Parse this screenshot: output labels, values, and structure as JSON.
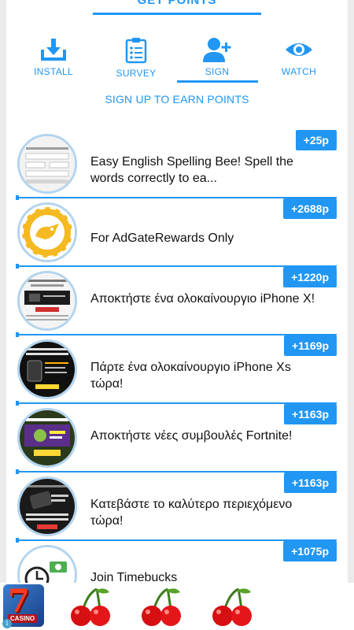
{
  "header": {
    "get_points_label": "GET POINTS"
  },
  "tabs": [
    {
      "label": "INSTALL",
      "icon": "download-icon"
    },
    {
      "label": "SURVEY",
      "icon": "clipboard-icon"
    },
    {
      "label": "SIGN",
      "icon": "add-user-icon",
      "active": true
    },
    {
      "label": "WATCH",
      "icon": "eye-icon"
    }
  ],
  "subtitle": "SIGN UP TO EARN POINTS",
  "offers": [
    {
      "points": "+25p",
      "title": "Easy English Spelling Bee! Spell the words correctly to ea..."
    },
    {
      "points": "+2688p",
      "title": "For AdGateRewards Only"
    },
    {
      "points": "+1220p",
      "title": "Αποκτήστε ένα ολοκαίνουργιο iPhone X!"
    },
    {
      "points": "+1169p",
      "title": "Πάρτε ένα ολοκαίνουργιο iPhone Xs τώρα!"
    },
    {
      "points": "+1163p",
      "title": "Αποκτήστε νέες συμβουλές Fortnite!"
    },
    {
      "points": "+1163p",
      "title": "Κατεβάστε το καλύτερο περιεχόμενο τώρα!"
    },
    {
      "points": "+1075p",
      "title": "Join Timebucks"
    }
  ],
  "ad": {
    "casino_label": "CASINO",
    "info_icon": "info-icon"
  },
  "colors": {
    "accent": "#2196f3",
    "ring": "#b3d4ee",
    "background": "#ebebeb"
  }
}
